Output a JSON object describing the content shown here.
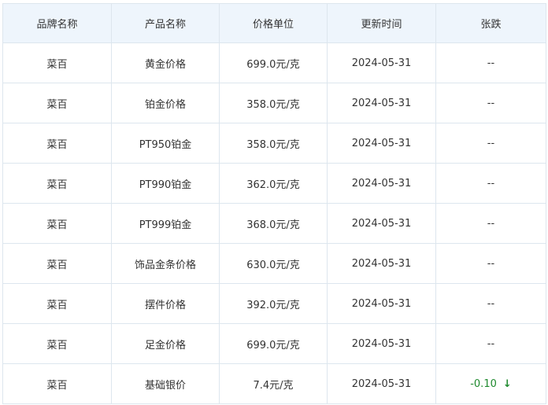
{
  "table": {
    "headers": [
      "品牌名称",
      "产品名称",
      "价格单位",
      "更新时间",
      "张跌"
    ],
    "rows": [
      {
        "brand": "菜百",
        "product": "黄金价格",
        "price": "699.0元/克",
        "date": "2024-05-31",
        "change": "--"
      },
      {
        "brand": "菜百",
        "product": "铂金价格",
        "price": "358.0元/克",
        "date": "2024-05-31",
        "change": "--"
      },
      {
        "brand": "菜百",
        "product": "PT950铂金",
        "price": "358.0元/克",
        "date": "2024-05-31",
        "change": "--"
      },
      {
        "brand": "菜百",
        "product": "PT990铂金",
        "price": "362.0元/克",
        "date": "2024-05-31",
        "change": "--"
      },
      {
        "brand": "菜百",
        "product": "PT999铂金",
        "price": "368.0元/克",
        "date": "2024-05-31",
        "change": "--"
      },
      {
        "brand": "菜百",
        "product": "饰品金条价格",
        "price": "630.0元/克",
        "date": "2024-05-31",
        "change": "--"
      },
      {
        "brand": "菜百",
        "product": "摆件价格",
        "price": "392.0元/克",
        "date": "2024-05-31",
        "change": "--"
      },
      {
        "brand": "菜百",
        "product": "足金价格",
        "price": "699.0元/克",
        "date": "2024-05-31",
        "change": "--"
      },
      {
        "brand": "菜百",
        "product": "基础银价",
        "price": "7.4元/克",
        "date": "2024-05-31",
        "change": "-0.10",
        "arrow": "↓"
      }
    ]
  },
  "colors": {
    "header_bg": "#eef5fc",
    "border": "#dde6ee",
    "down": "#1f8a2e"
  }
}
